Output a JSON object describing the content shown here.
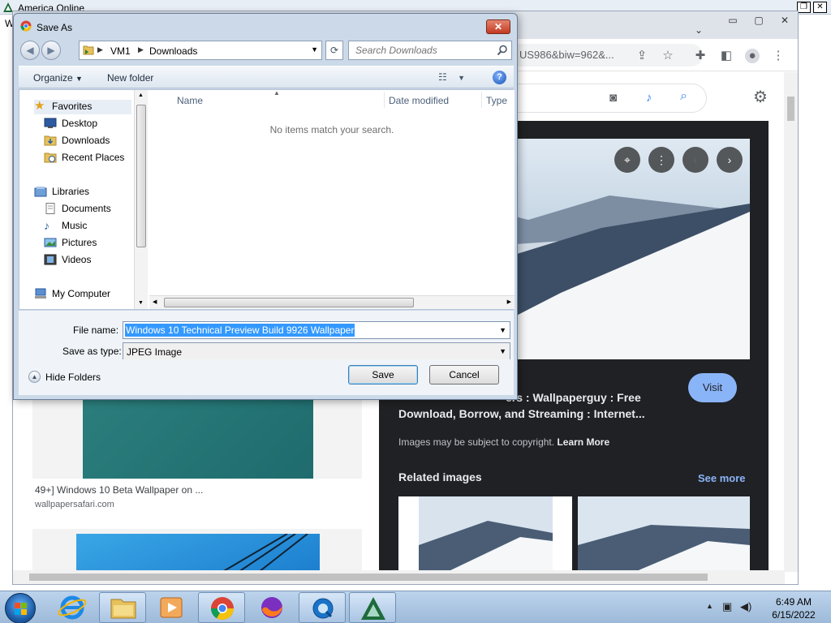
{
  "aol": {
    "title": "America  Online",
    "partial_letter": "W"
  },
  "chrome": {
    "url_tail": "US986&biw=962&...",
    "thumbnail_caption": "49+] Windows 10 Beta Wallpaper on ...",
    "thumbnail_source": "wallpapersafari.com",
    "preview": {
      "title_line1": "ers : Wallpaperguy : Free",
      "title_line2": "Download, Borrow, and Streaming : Internet...",
      "copyright": "Images may be subject to copyright.",
      "learn_more": "Learn More",
      "visit_label": "Visit",
      "related_title": "Related images",
      "see_more": "See more"
    }
  },
  "dialog": {
    "title": "Save As",
    "breadcrumb": [
      "VM1",
      "Downloads"
    ],
    "search_placeholder": "Search Downloads",
    "organize_label": "Organize",
    "new_folder_label": "New folder",
    "nav_items": {
      "favorites": "Favorites",
      "desktop": "Desktop",
      "downloads": "Downloads",
      "recent_places": "Recent Places",
      "libraries": "Libraries",
      "documents": "Documents",
      "music": "Music",
      "pictures": "Pictures",
      "videos": "Videos",
      "my_computer": "My Computer"
    },
    "columns": {
      "name": "Name",
      "date_modified": "Date modified",
      "type": "Type"
    },
    "empty_message": "No items match your search.",
    "file_name_label": "File name:",
    "file_name_value": "Windows 10 Technical Preview Build 9926 Wallpaper",
    "save_as_type_label": "Save as type:",
    "save_as_type_value": "JPEG Image",
    "hide_folders_label": "Hide Folders",
    "save_label": "Save",
    "cancel_label": "Cancel"
  },
  "taskbar": {
    "time": "6:49 AM",
    "date": "6/15/2022"
  },
  "colors": {
    "dialog_bg": "#cbd9e8",
    "selection": "#3399ff",
    "preview_bg": "#202124",
    "link_blue": "#8ab4f8",
    "taskbar": "#bcd3ec"
  },
  "icons": [
    "aol-logo-icon",
    "chrome-icon",
    "back-icon",
    "forward-icon",
    "refresh-icon",
    "search-icon",
    "help-icon",
    "folder-icon",
    "star-icon",
    "music-icon",
    "camera-icon",
    "mic-icon",
    "gear-icon",
    "share-icon",
    "extensions-icon",
    "profile-icon",
    "ie-icon",
    "explorer-icon",
    "media-icon",
    "firefox-icon",
    "quicktime-icon"
  ]
}
